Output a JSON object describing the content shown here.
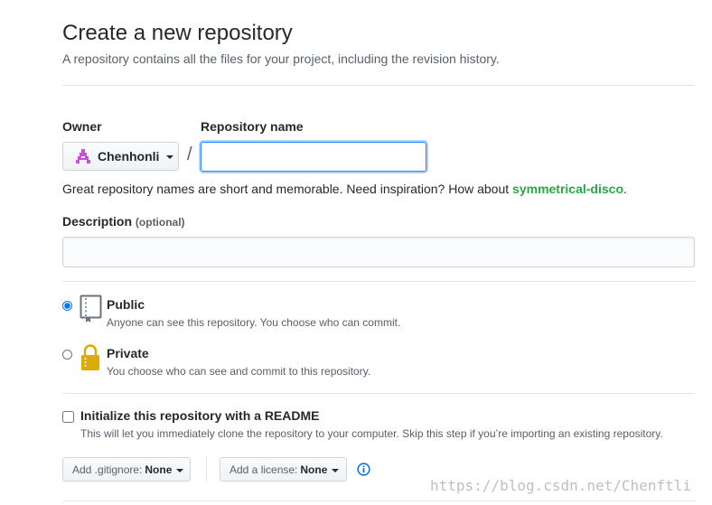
{
  "header": {
    "title": "Create a new repository",
    "subtitle": "A repository contains all the files for your project, including the revision history."
  },
  "owner": {
    "label": "Owner",
    "value": "Chenhonli",
    "avatar_color": "#c94fd9"
  },
  "repo": {
    "label": "Repository name",
    "value": "",
    "separator": "/"
  },
  "hint": {
    "text": "Great repository names are short and memorable. Need inspiration? How about ",
    "suggestion": "symmetrical-disco",
    "end": "."
  },
  "description": {
    "label": "Description",
    "optional": "(optional)",
    "value": ""
  },
  "visibility": {
    "public": {
      "title": "Public",
      "note": "Anyone can see this repository. You choose who can commit.",
      "selected": true,
      "icon": "repo-book-icon"
    },
    "private": {
      "title": "Private",
      "note": "You choose who can see and commit to this repository.",
      "selected": false,
      "icon": "lock-icon"
    }
  },
  "readme": {
    "title": "Initialize this repository with a README",
    "note": "This will let you immediately clone the repository to your computer. Skip this step if you’re importing an existing repository.",
    "checked": false
  },
  "gitignore": {
    "prefix": "Add .gitignore:",
    "value": "None"
  },
  "license": {
    "prefix": "Add a license:",
    "value": "None"
  },
  "watermark": "https://blog.csdn.net/Chenftli",
  "colors": {
    "accent": "#2188ff",
    "suggestion": "#28a745",
    "muted": "#586069",
    "info": "#0366d6"
  }
}
